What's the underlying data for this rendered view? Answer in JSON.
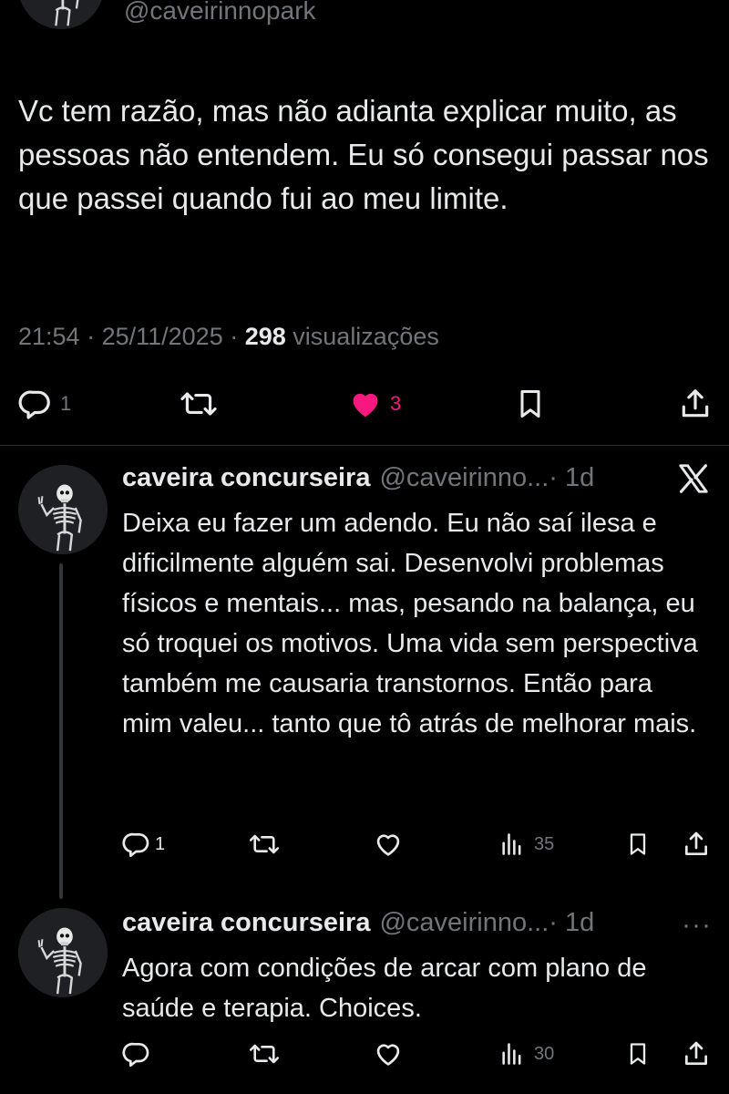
{
  "main_tweet": {
    "handle": "@caveirinnopark",
    "text": "Vc tem razão, mas não adianta explicar muito, as pessoas não entendem. Eu só consegui passar nos que passei quando fui ao meu limite.",
    "time": "21:54",
    "sep1": " · ",
    "date": "25/11/2025",
    "sep2": " · ",
    "views": "298",
    "views_label": " visualizações",
    "replies_count": "1",
    "likes_count": "3"
  },
  "replies": [
    {
      "name": "caveira concurseira",
      "handle": "@caveirinno...",
      "time": " · 1d",
      "text": "Deixa eu fazer um adendo. Eu não saí ilesa e dificilmente alguém sai. Desenvolvi problemas físicos e mentais... mas, pesando na balança, eu só troquei os motivos. Uma vida sem perspectiva também me causaria transtornos. Então para mim valeu... tanto que tô atrás de melhorar mais.",
      "replies_count": "1",
      "views": "35"
    },
    {
      "name": "caveira concurseira",
      "handle": "@caveirinno...",
      "time": " · 1d",
      "text": "Agora com condições de arcar com plano de saúde e terapia. Choices.",
      "views": "30"
    }
  ],
  "more_label": "···",
  "colors": {
    "background": "#000000",
    "text": "#e7e9ea",
    "muted": "#71767b",
    "like_active": "#f91880",
    "divider": "#2f3336"
  },
  "icons": [
    "reply-icon",
    "retweet-icon",
    "heart-icon",
    "bookmark-icon",
    "share-icon",
    "views-icon",
    "x-logo-icon",
    "more-icon"
  ]
}
